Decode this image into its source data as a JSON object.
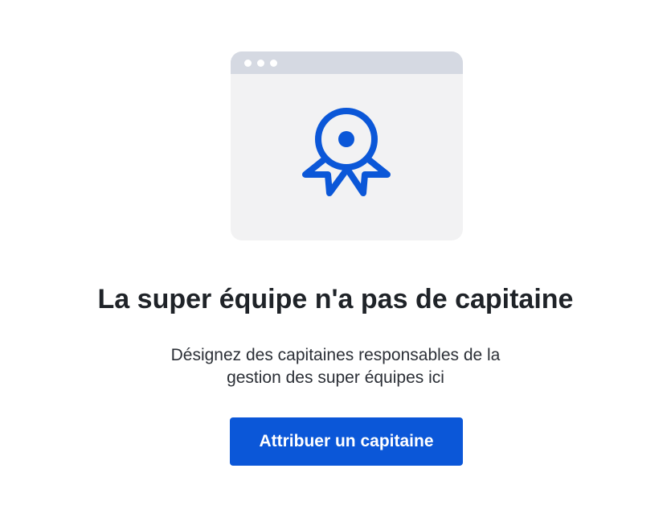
{
  "empty_state": {
    "illustration": {
      "icon": "award-ribbon-icon",
      "window_bar_color": "#d5d9e2",
      "panel_color": "#f2f2f3",
      "icon_color": "#0b57d8"
    },
    "title": "La super équipe n'a pas de capitaine",
    "description_line1": "Désignez des capitaines responsables de la",
    "description_line2": "gestion des super équipes ici",
    "button_label": "Attribuer un capitaine",
    "accent_color": "#0b57d8"
  }
}
